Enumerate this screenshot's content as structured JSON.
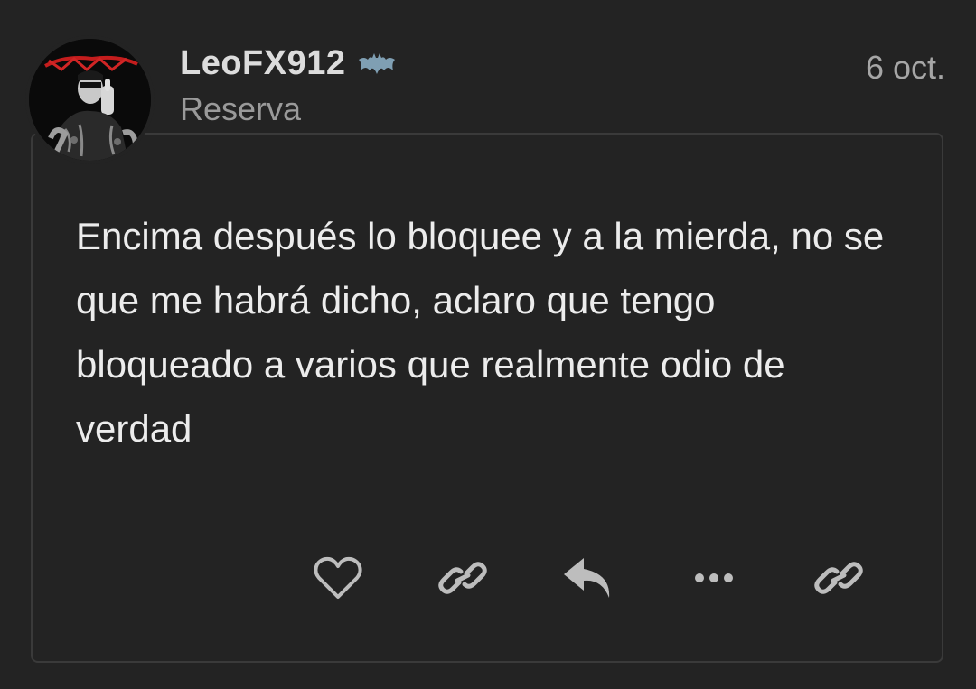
{
  "post": {
    "author": {
      "username": "LeoFX912",
      "badge_icon": "bat-icon",
      "subtitle": "Reserva",
      "avatar_icon": "avatar-image"
    },
    "date": "6 oct.",
    "body": "Encima después lo bloquee y a la mierda, no se que me habrá dicho, aclaro que tengo bloqueado a varios que realmente odio de verdad",
    "actions": [
      {
        "name": "like-button",
        "icon": "heart-icon"
      },
      {
        "name": "copy-link-button",
        "icon": "link-icon"
      },
      {
        "name": "reply-button",
        "icon": "reply-icon"
      },
      {
        "name": "more-button",
        "icon": "ellipsis-icon"
      },
      {
        "name": "share-link-button",
        "icon": "link-icon"
      }
    ]
  },
  "colors": {
    "background": "#232323",
    "card_border": "#3a3a3a",
    "text_primary": "#ececec",
    "text_secondary": "#9a9a9a",
    "icon": "#bdbdbd"
  }
}
